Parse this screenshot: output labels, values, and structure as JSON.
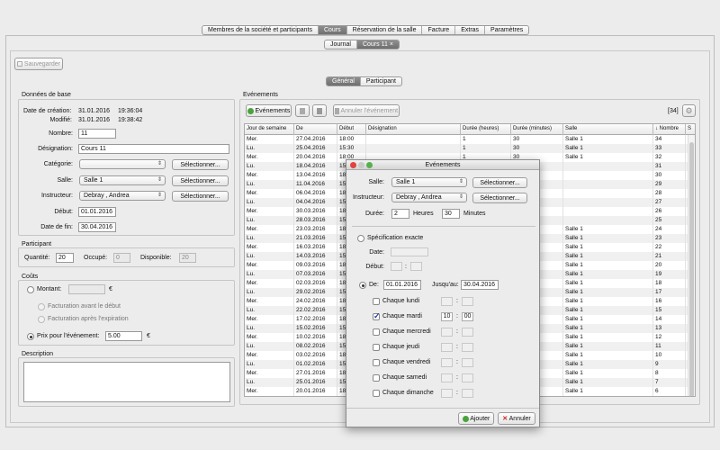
{
  "top_tabs": [
    {
      "label": "Membres de la société et participants"
    },
    {
      "label": "Cours"
    },
    {
      "label": "Réservation  de la salle"
    },
    {
      "label": "Facture"
    },
    {
      "label": "Extras"
    },
    {
      "label": "Paramètres"
    }
  ],
  "doc_tabs": {
    "journal": "Journal",
    "cours": "Cours 11",
    "close": "×"
  },
  "toolbar": {
    "save": "Sauvegarder"
  },
  "sub_tabs": {
    "general": "Général",
    "participant": "Participant"
  },
  "base": {
    "title": "Données de base",
    "created_label": "Date de création:",
    "created_date": "31.01.2016",
    "created_time": "19:36:04",
    "modified_label": "Modifié:",
    "modified_date": "31.01.2016",
    "modified_time": "19:38:42",
    "number_label": "Nombre:",
    "number_value": "11",
    "designation_label": "Désignation:",
    "designation_value": "Cours 11",
    "category_label": "Catégorie:",
    "category_value": "",
    "room_label": "Salle:",
    "room_value": "Salle 1",
    "instructor_label": "Instructeur:",
    "instructor_value": "Debray , Andrea",
    "select_btn": "Sélectionner...",
    "start_label": "Début:",
    "start_value": "01.01.2016",
    "end_label": "Date de fin:",
    "end_value": "30.04.2016"
  },
  "participant": {
    "title": "Participant",
    "qty_label": "Quantité:",
    "qty_value": "20",
    "occ_label": "Occupé:",
    "occ_value": "0",
    "avail_label": "Disponible:",
    "avail_value": "20"
  },
  "costs": {
    "title": "Coûts",
    "amount_label": "Montant:",
    "currency": "€",
    "before_label": "Facturation avant le début",
    "after_label": "Facturation après l'expiration",
    "price_label": "Prix pour l'événement:",
    "price_value": "5.00"
  },
  "description": {
    "title": "Description"
  },
  "events": {
    "title": "Evénements",
    "add_btn": "Evénements",
    "cancel_btn": "Annuler l'événement",
    "count": "[34]",
    "columns": [
      "Jour de semaine",
      "De",
      "Début",
      "Désignation",
      "Durée (heures)",
      "Durée (minutes)",
      "Salle",
      "↓ Nombre",
      "S"
    ],
    "rows": [
      [
        "Mer.",
        "27.04.2016",
        "18:00",
        "",
        "1",
        "30",
        "Salle 1",
        "34"
      ],
      [
        "Lu.",
        "25.04.2016",
        "15:30",
        "",
        "1",
        "30",
        "Salle 1",
        "33"
      ],
      [
        "Mer.",
        "20.04.2016",
        "18:00",
        "",
        "1",
        "30",
        "Salle 1",
        "32"
      ],
      [
        "Lu.",
        "18.04.2016",
        "15",
        "",
        "",
        "",
        "",
        "31"
      ],
      [
        "Mer.",
        "13.04.2016",
        "18",
        "",
        "",
        "",
        "",
        "30"
      ],
      [
        "Lu.",
        "11.04.2016",
        "15",
        "",
        "",
        "",
        "",
        "29"
      ],
      [
        "Mer.",
        "06.04.2016",
        "18",
        "",
        "",
        "",
        "",
        "28"
      ],
      [
        "Lu.",
        "04.04.2016",
        "15",
        "",
        "",
        "",
        "",
        "27"
      ],
      [
        "Mer.",
        "30.03.2016",
        "18",
        "",
        "",
        "",
        "",
        "26"
      ],
      [
        "Lu.",
        "28.03.2016",
        "15",
        "",
        "",
        "",
        "",
        "25"
      ],
      [
        "Mer.",
        "23.03.2016",
        "18",
        "",
        "",
        "",
        "Salle 1",
        "24"
      ],
      [
        "Lu.",
        "21.03.2016",
        "15",
        "",
        "",
        "",
        "Salle 1",
        "23"
      ],
      [
        "Mer.",
        "16.03.2016",
        "18",
        "",
        "",
        "",
        "Salle 1",
        "22"
      ],
      [
        "Lu.",
        "14.03.2016",
        "15",
        "",
        "",
        "",
        "Salle 1",
        "21"
      ],
      [
        "Mer.",
        "09.03.2016",
        "18",
        "",
        "",
        "",
        "Salle 1",
        "20"
      ],
      [
        "Lu.",
        "07.03.2016",
        "15",
        "",
        "",
        "",
        "Salle 1",
        "19"
      ],
      [
        "Mer.",
        "02.03.2016",
        "18",
        "",
        "",
        "",
        "Salle 1",
        "18"
      ],
      [
        "Lu.",
        "29.02.2016",
        "15",
        "",
        "",
        "",
        "Salle 1",
        "17"
      ],
      [
        "Mer.",
        "24.02.2016",
        "18",
        "",
        "",
        "",
        "Salle 1",
        "16"
      ],
      [
        "Lu.",
        "22.02.2016",
        "15",
        "",
        "",
        "",
        "Salle 1",
        "15"
      ],
      [
        "Mer.",
        "17.02.2016",
        "18",
        "",
        "",
        "",
        "Salle 1",
        "14"
      ],
      [
        "Lu.",
        "15.02.2016",
        "15",
        "",
        "",
        "",
        "Salle 1",
        "13"
      ],
      [
        "Mer.",
        "10.02.2016",
        "18",
        "",
        "",
        "",
        "Salle 1",
        "12"
      ],
      [
        "Lu.",
        "08.02.2016",
        "15",
        "",
        "",
        "",
        "Salle 1",
        "11"
      ],
      [
        "Mer.",
        "03.02.2016",
        "18",
        "",
        "",
        "",
        "Salle 1",
        "10"
      ],
      [
        "Lu.",
        "01.02.2016",
        "15",
        "",
        "",
        "",
        "Salle 1",
        "9"
      ],
      [
        "Mer.",
        "27.01.2016",
        "18",
        "",
        "",
        "",
        "Salle 1",
        "8"
      ],
      [
        "Lu.",
        "25.01.2016",
        "15",
        "",
        "",
        "",
        "Salle 1",
        "7"
      ],
      [
        "Mer.",
        "20.01.2016",
        "18",
        "",
        "",
        "",
        "Salle 1",
        "6"
      ]
    ]
  },
  "dialog": {
    "title": "Evénements",
    "room_label": "Salle:",
    "room_value": "Salle 1",
    "instructor_label": "Instructeur:",
    "instructor_value": "Debray , Andrea",
    "select_btn": "Sélectionner...",
    "duration_label": "Durée:",
    "hours_value": "2",
    "hours_label": "Heures",
    "minutes_value": "30",
    "minutes_label": "Minutes",
    "exact_label": "Spécification exacte",
    "date_label": "Date:",
    "start_label": "Début:",
    "from_label": "De:",
    "from_value": "01.01.2016",
    "to_label": "Jusqu'au:",
    "to_value": "30.04.2016",
    "days": [
      {
        "label": "Chaque lundi",
        "checked": false,
        "h": "",
        "m": ""
      },
      {
        "label": "Chaque mardi",
        "checked": true,
        "h": "10",
        "m": "00"
      },
      {
        "label": "Chaque mercredi",
        "checked": false,
        "h": "",
        "m": ""
      },
      {
        "label": "Chaque jeudi",
        "checked": false,
        "h": "",
        "m": ""
      },
      {
        "label": "Chaque vendredi",
        "checked": false,
        "h": "",
        "m": ""
      },
      {
        "label": "Chaque samedi",
        "checked": false,
        "h": "",
        "m": ""
      },
      {
        "label": "Chaque dimanche",
        "checked": false,
        "h": "",
        "m": ""
      }
    ],
    "colon": ":",
    "add_btn": "Ajouter",
    "cancel_btn": "Annuler"
  }
}
